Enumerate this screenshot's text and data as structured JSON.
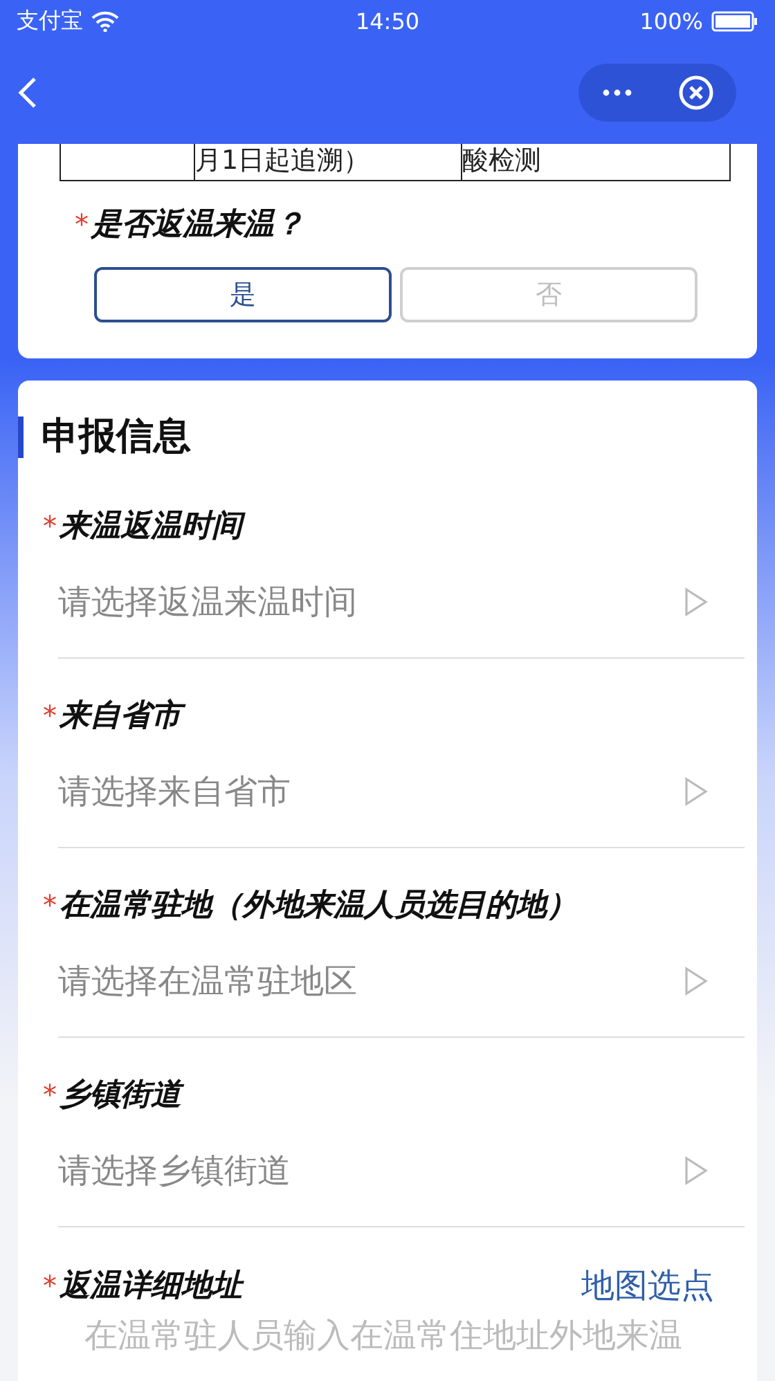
{
  "status_bar": {
    "carrier": "支付宝",
    "time": "14:50",
    "battery": "100%"
  },
  "table_row": {
    "cells": [
      "月1日起追溯）",
      "酸检测"
    ]
  },
  "question": {
    "label": "是否返温来温？",
    "mark": "*",
    "options": [
      {
        "label": "是",
        "selected": true
      },
      {
        "label": "否",
        "selected": false
      }
    ]
  },
  "section": {
    "title": "申报信息",
    "fields": [
      {
        "kind": "picker",
        "label": "来温返温时间",
        "mark": "*",
        "placeholder": "请选择返温来温时间"
      },
      {
        "kind": "picker",
        "label": "来自省市",
        "mark": "*",
        "placeholder": "请选择来自省市"
      },
      {
        "kind": "picker",
        "label": "在温常驻地（外地来温人员选目的地）",
        "mark": "*",
        "placeholder": "请选择在温常驻地区"
      },
      {
        "kind": "picker",
        "label": "乡镇街道",
        "mark": "*",
        "placeholder": "请选择乡镇街道"
      },
      {
        "kind": "textarea",
        "label": "返温详细地址",
        "mark": "*",
        "action": "地图选点",
        "placeholder": "在温常驻人员输入在温常住地址外地来温"
      }
    ]
  }
}
